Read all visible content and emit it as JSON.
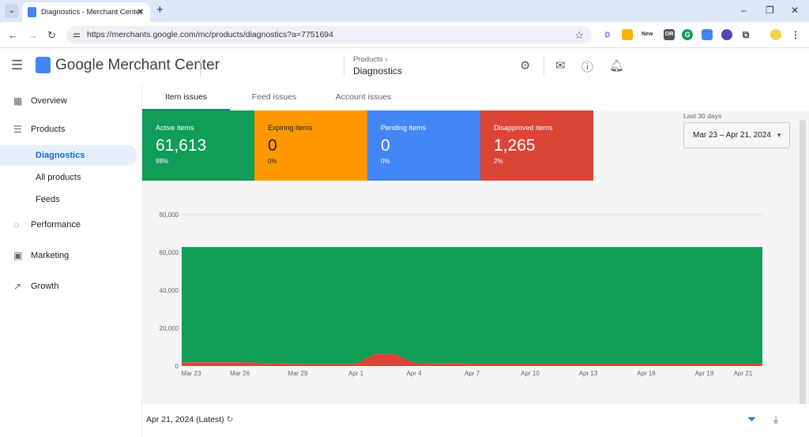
{
  "browser": {
    "tab_title": "Diagnostics - Merchant Center",
    "url": "https://merchants.google.com/mc/products/diagnostics?a=7751694"
  },
  "header": {
    "brand": "Google Merchant Center",
    "breadcrumb_parent": "Products",
    "breadcrumb_current": "Diagnostics"
  },
  "sidebar": {
    "items": [
      {
        "label": "Overview",
        "icon": "dashboard-icon"
      },
      {
        "label": "Products",
        "icon": "list-icon"
      },
      {
        "label": "Diagnostics",
        "active": true
      },
      {
        "label": "All products"
      },
      {
        "label": "Feeds"
      },
      {
        "label": "Performance",
        "icon": "donut-icon"
      },
      {
        "label": "Marketing",
        "icon": "bag-icon"
      },
      {
        "label": "Growth",
        "icon": "trend-icon"
      }
    ]
  },
  "tabs": [
    {
      "label": "Item issues",
      "active": true
    },
    {
      "label": "Feed issues"
    },
    {
      "label": "Account issues"
    }
  ],
  "cards": [
    {
      "title": "Active items",
      "value": "61,613",
      "pct": "98%",
      "color": "#0f9d58"
    },
    {
      "title": "Expiring items",
      "value": "0",
      "pct": "0%",
      "color": "#ff9800"
    },
    {
      "title": "Pending items",
      "value": "0",
      "pct": "0%",
      "color": "#4285f4"
    },
    {
      "title": "Disapproved items",
      "value": "1,265",
      "pct": "2%",
      "color": "#db4437"
    }
  ],
  "date_range": {
    "label": "Last 30 days",
    "value": "Mar 23 – Apr 21, 2024"
  },
  "footer": {
    "date": "Apr 21, 2024 (Latest)"
  },
  "chart_data": {
    "type": "area",
    "stacked": true,
    "grid": true,
    "ylim": [
      0,
      80000
    ],
    "yticks": [
      "0",
      "20,000",
      "40,000",
      "60,000",
      "80,000"
    ],
    "xticks": [
      "Mar 23",
      "Mar 26",
      "Mar 29",
      "Apr 1",
      "Apr 4",
      "Apr 7",
      "Apr 10",
      "Apr 13",
      "Apr 16",
      "Apr 19",
      "Apr 21"
    ],
    "x": [
      "Mar 23",
      "Mar 24",
      "Mar 25",
      "Mar 26",
      "Mar 27",
      "Mar 28",
      "Mar 29",
      "Mar 30",
      "Mar 31",
      "Apr 1",
      "Apr 2",
      "Apr 3",
      "Apr 4",
      "Apr 5",
      "Apr 6",
      "Apr 7",
      "Apr 8",
      "Apr 9",
      "Apr 10",
      "Apr 11",
      "Apr 12",
      "Apr 13",
      "Apr 14",
      "Apr 15",
      "Apr 16",
      "Apr 17",
      "Apr 18",
      "Apr 19",
      "Apr 20",
      "Apr 21",
      "Apr 22"
    ],
    "series": [
      {
        "key": "disapproved",
        "color": "#db4437",
        "values": [
          2000,
          2000,
          2000,
          2000,
          1700,
          1400,
          1100,
          1100,
          1100,
          1100,
          6600,
          6300,
          1700,
          1600,
          1500,
          1265,
          1265,
          1265,
          1265,
          1265,
          1265,
          1265,
          1265,
          1265,
          1265,
          1265,
          1265,
          1265,
          1265,
          1265,
          1265
        ]
      },
      {
        "key": "active",
        "color": "#0f9d58",
        "values": [
          60878,
          60878,
          60878,
          60878,
          61178,
          61478,
          61778,
          61778,
          61778,
          61778,
          56278,
          56578,
          61178,
          61278,
          61378,
          61613,
          61613,
          61613,
          61613,
          61613,
          61613,
          61613,
          61613,
          61613,
          61613,
          61613,
          61613,
          61613,
          61613,
          61613,
          61613
        ]
      }
    ]
  }
}
